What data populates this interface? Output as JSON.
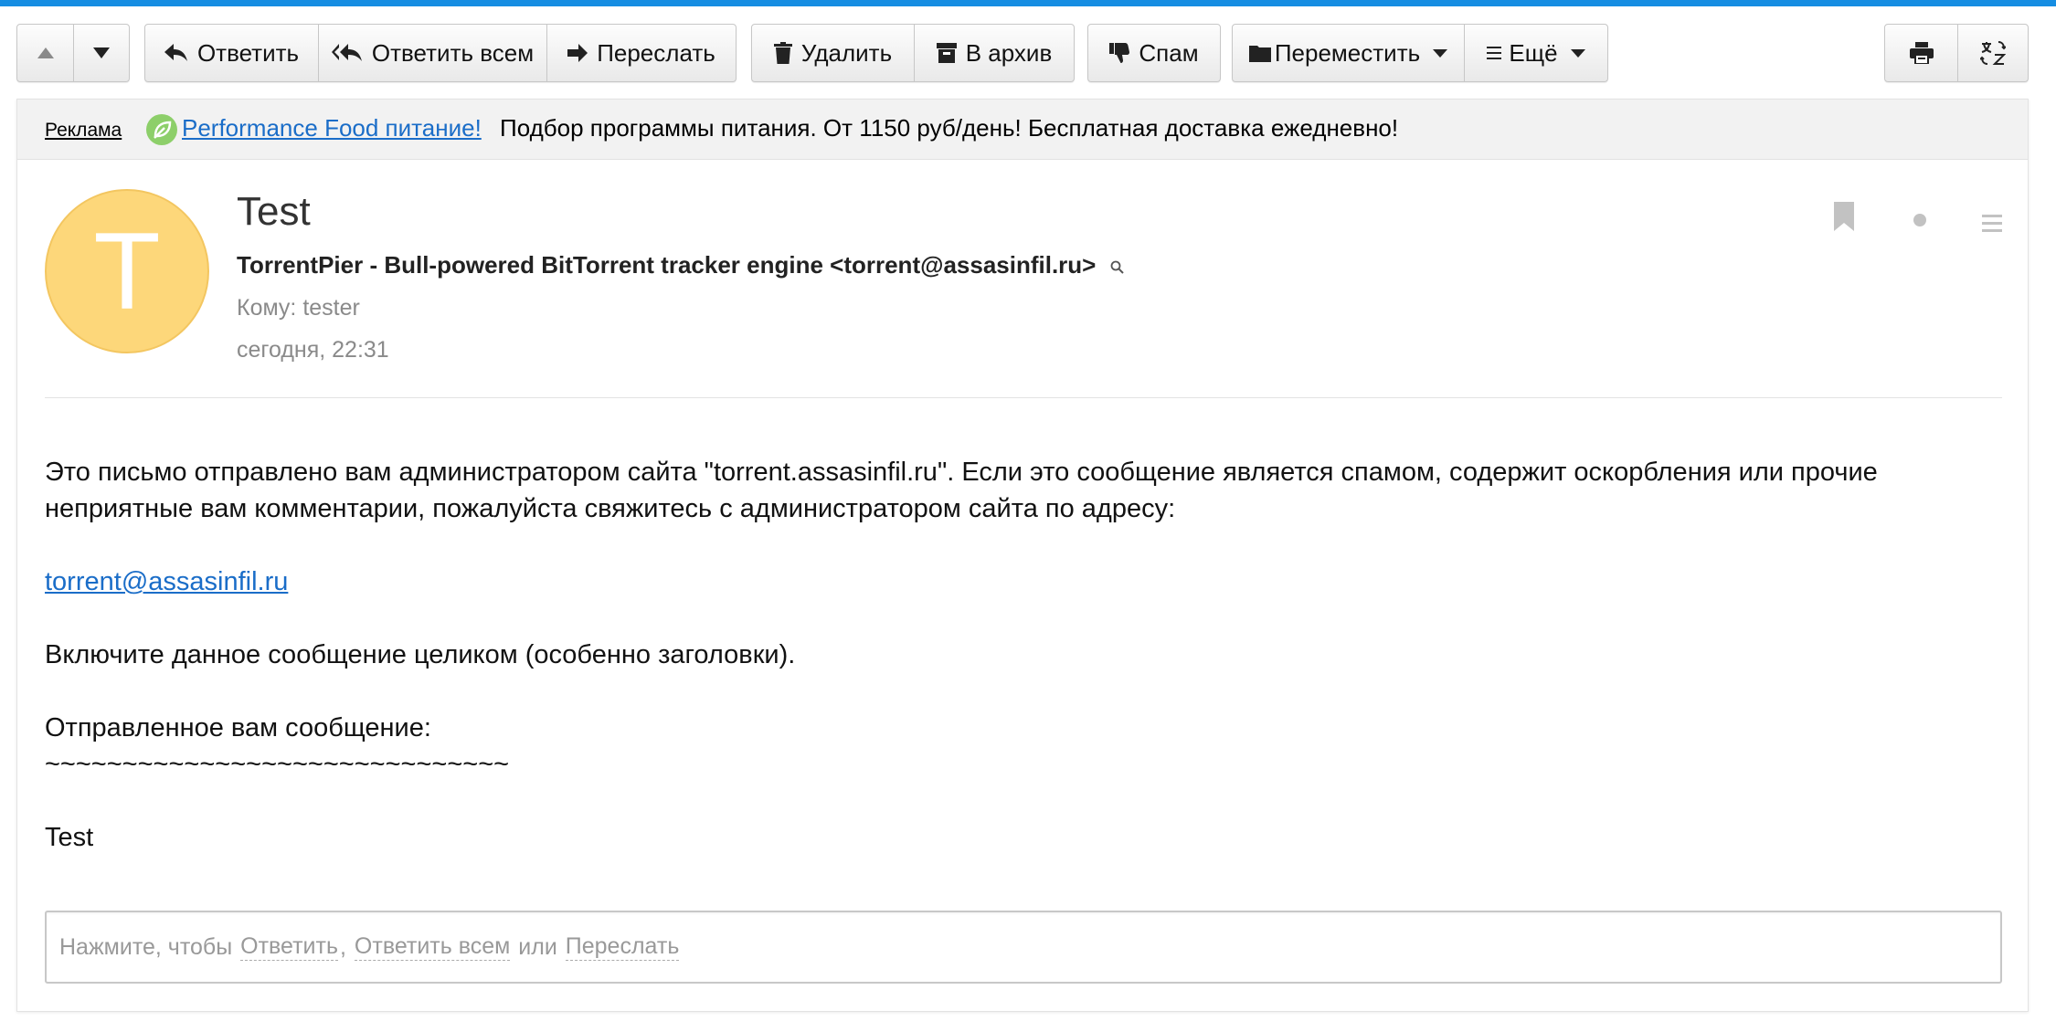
{
  "toolbar": {
    "reply": "Ответить",
    "reply_all": "Ответить всем",
    "forward": "Переслать",
    "delete": "Удалить",
    "archive": "В архив",
    "spam": "Спам",
    "move": "Переместить",
    "more": "Ещё"
  },
  "ad": {
    "label": "Реклама",
    "link": "Performance Food питание!",
    "text": "Подбор программы питания. От 1150 руб/день! Бесплатная доставка ежедневно!"
  },
  "message": {
    "avatar_letter": "T",
    "subject": "Test",
    "from": "TorrentPier - Bull-powered BitTorrent tracker engine <torrent@assasinfil.ru>",
    "to": "Кому: tester",
    "date": "сегодня, 22:31",
    "body": {
      "p1": "Это письмо отправлено вам администратором сайта \"torrent.assasinfil.ru\". Если это сообщение является спамом, содержит оскорбления или прочие неприятные вам комментарии, пожалуйста свяжитесь с администратором сайта по адресу:",
      "email": "torrent@assasinfil.ru",
      "p2": "Включите данное сообщение целиком (особенно заголовки).",
      "p3": "Отправленное вам сообщение:",
      "tilde": "~~~~~~~~~~~~~~~~~~~~~~~~~~~~~~",
      "p4": "Test"
    }
  },
  "reply_box": {
    "prefix": "Нажмите, чтобы",
    "reply": "Ответить",
    "comma": ",",
    "reply_all": "Ответить всем",
    "or": "или",
    "forward": "Переслать"
  },
  "colors": {
    "accent_stripe": "#168de2",
    "link": "#1a6dc8",
    "avatar_bg": "#fdd77a"
  }
}
